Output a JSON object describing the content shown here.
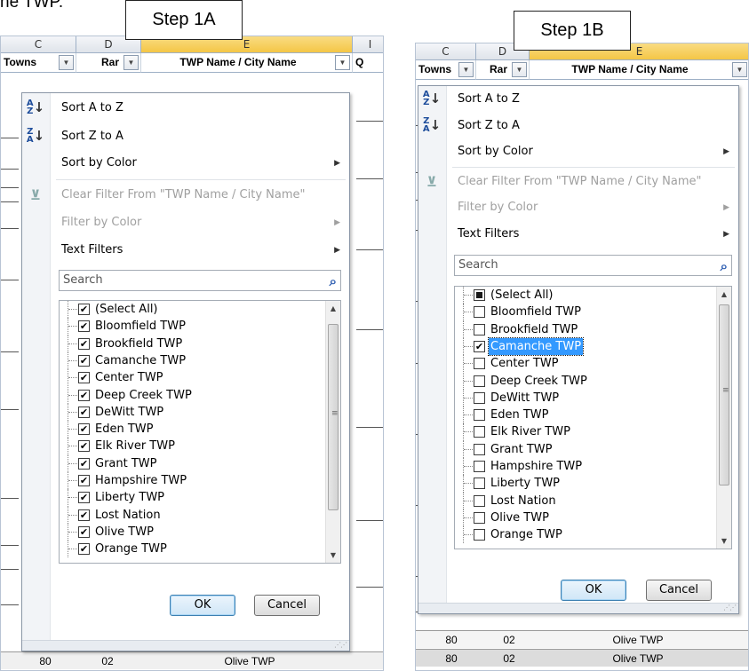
{
  "doc_text": "ne TWP.",
  "panels": [
    {
      "step_label": "Step 1A",
      "columns": [
        "C",
        "D",
        "E",
        "I"
      ],
      "filter_headers": [
        "Towns",
        "Rar",
        "TWP Name / City Name",
        "Q"
      ],
      "menu": {
        "sort_az": "Sort A to Z",
        "sort_za": "Sort Z to A",
        "sort_color": "Sort by Color",
        "clear_filter": "Clear Filter From \"TWP Name / City Name\"",
        "filter_color": "Filter by Color",
        "text_filters": "Text Filters",
        "search_placeholder": "Search",
        "items": [
          {
            "label": "(Select All)",
            "checked": true
          },
          {
            "label": "Bloomfield TWP",
            "checked": true
          },
          {
            "label": "Brookfield TWP",
            "checked": true
          },
          {
            "label": "Camanche TWP",
            "checked": true
          },
          {
            "label": "Center TWP",
            "checked": true
          },
          {
            "label": "Deep Creek TWP",
            "checked": true
          },
          {
            "label": "DeWitt TWP",
            "checked": true
          },
          {
            "label": "Eden TWP",
            "checked": true
          },
          {
            "label": "Elk River TWP",
            "checked": true
          },
          {
            "label": "Grant TWP",
            "checked": true
          },
          {
            "label": "Hampshire TWP",
            "checked": true
          },
          {
            "label": "Liberty TWP",
            "checked": true
          },
          {
            "label": "Lost Nation",
            "checked": true
          },
          {
            "label": "Olive TWP",
            "checked": true
          },
          {
            "label": "Orange TWP",
            "checked": true
          }
        ],
        "ok": "OK",
        "cancel": "Cancel"
      },
      "bottom_row": [
        "80",
        "02",
        "Olive TWP"
      ]
    },
    {
      "step_label": "Step 1B",
      "columns": [
        "C",
        "D",
        "E"
      ],
      "filter_headers": [
        "Towns",
        "Rar",
        "TWP Name / City Name"
      ],
      "menu": {
        "sort_az": "Sort A to Z",
        "sort_za": "Sort Z to A",
        "sort_color": "Sort by Color",
        "clear_filter": "Clear Filter From \"TWP Name / City Name\"",
        "filter_color": "Filter by Color",
        "text_filters": "Text Filters",
        "search_placeholder": "Search",
        "items": [
          {
            "label": "(Select All)",
            "checked": "partial"
          },
          {
            "label": "Bloomfield TWP",
            "checked": false
          },
          {
            "label": "Brookfield TWP",
            "checked": false
          },
          {
            "label": "Camanche TWP",
            "checked": true,
            "selected": true
          },
          {
            "label": "Center TWP",
            "checked": false
          },
          {
            "label": "Deep Creek TWP",
            "checked": false
          },
          {
            "label": "DeWitt TWP",
            "checked": false
          },
          {
            "label": "Eden TWP",
            "checked": false
          },
          {
            "label": "Elk River TWP",
            "checked": false
          },
          {
            "label": "Grant TWP",
            "checked": false
          },
          {
            "label": "Hampshire TWP",
            "checked": false
          },
          {
            "label": "Liberty TWP",
            "checked": false
          },
          {
            "label": "Lost Nation",
            "checked": false
          },
          {
            "label": "Olive TWP",
            "checked": false
          },
          {
            "label": "Orange TWP",
            "checked": false
          }
        ],
        "ok": "OK",
        "cancel": "Cancel"
      },
      "bottom_rows": [
        [
          "80",
          "02",
          "Olive TWP"
        ],
        [
          "80",
          "02",
          "Olive TWP"
        ]
      ]
    }
  ],
  "colors": {
    "selected_column": "#f4c646",
    "selection_highlight": "#3399ff",
    "default_button_border": "#3c7fb1"
  }
}
